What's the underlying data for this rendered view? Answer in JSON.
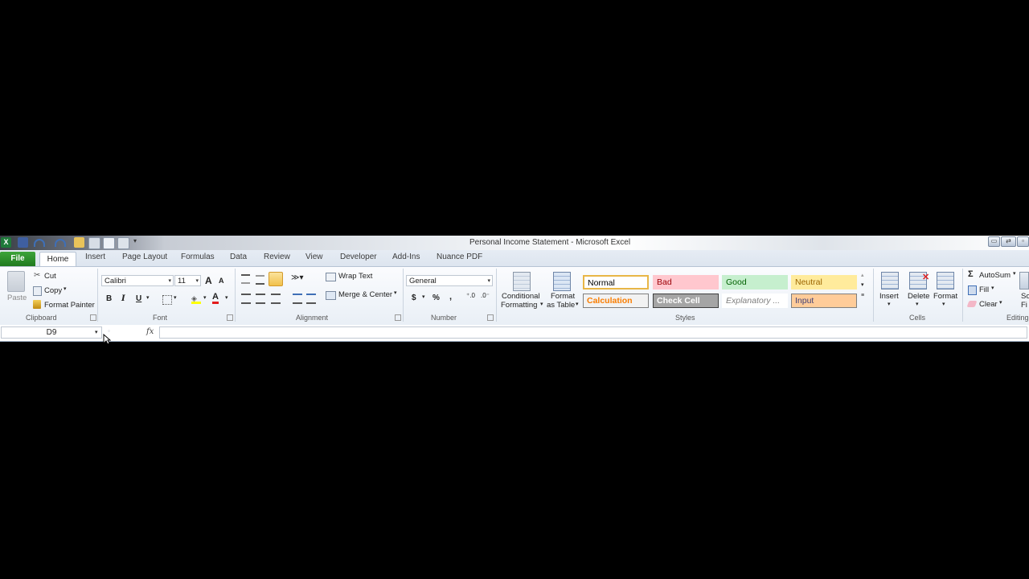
{
  "window": {
    "title": "Personal Income Statement  -  Microsoft Excel"
  },
  "quick_access": [
    "excel-icon",
    "save-icon",
    "undo-icon",
    "redo-icon",
    "open-icon",
    "print-preview-icon",
    "new-icon",
    "customize-icon"
  ],
  "tabs": [
    "File",
    "Home",
    "Insert",
    "Page Layout",
    "Formulas",
    "Data",
    "Review",
    "View",
    "Developer",
    "Add-Ins",
    "Nuance PDF"
  ],
  "active_tab": "Home",
  "clipboard": {
    "paste": "Paste",
    "cut": "Cut",
    "copy": "Copy",
    "format_painter": "Format Painter",
    "label": "Clipboard"
  },
  "font": {
    "name": "Calibri",
    "size": "11",
    "bold": "B",
    "italic": "I",
    "underline": "U",
    "grow": "A",
    "shrink": "A",
    "color_glyph": "A",
    "label": "Font"
  },
  "alignment": {
    "wrap_text": "Wrap Text",
    "merge_center": "Merge & Center",
    "label": "Alignment"
  },
  "number": {
    "format": "General",
    "currency": "$",
    "percent": "%",
    "comma": ",",
    "label": "Number"
  },
  "styles": {
    "conditional_formatting": [
      "Conditional",
      "Formatting"
    ],
    "format_as_table": [
      "Format",
      "as Table"
    ],
    "cells": [
      {
        "name": "Normal",
        "bg": "#ffffff",
        "fg": "#000000",
        "border": "#e8b647"
      },
      {
        "name": "Bad",
        "bg": "#ffc7ce",
        "fg": "#9c0006",
        "border": "#ffc7ce"
      },
      {
        "name": "Good",
        "bg": "#c6efce",
        "fg": "#006100",
        "border": "#c6efce"
      },
      {
        "name": "Neutral",
        "bg": "#ffeb9c",
        "fg": "#9c6500",
        "border": "#ffeb9c"
      },
      {
        "name": "Calculation",
        "bg": "#f2f2f2",
        "fg": "#fa7d00",
        "border": "#7f7f7f"
      },
      {
        "name": "Check Cell",
        "bg": "#a5a5a5",
        "fg": "#ffffff",
        "border": "#3f3f3f"
      },
      {
        "name": "Explanatory ...",
        "bg": "#ffffff",
        "fg": "#7f7f7f",
        "border": "#ffffff"
      },
      {
        "name": "Input",
        "bg": "#ffcc99",
        "fg": "#3f3f76",
        "border": "#7f7f7f"
      }
    ],
    "label": "Styles"
  },
  "cells": {
    "insert": "Insert",
    "delete": "Delete",
    "format": "Format",
    "label": "Cells"
  },
  "editing": {
    "autosum": "AutoSum",
    "fill": "Fill",
    "clear": "Clear",
    "sort_partial": "So",
    "find_partial": "Fi",
    "label": "Editing"
  },
  "formula_bar": {
    "name_box": "D9",
    "fx": "fx",
    "value": ""
  }
}
